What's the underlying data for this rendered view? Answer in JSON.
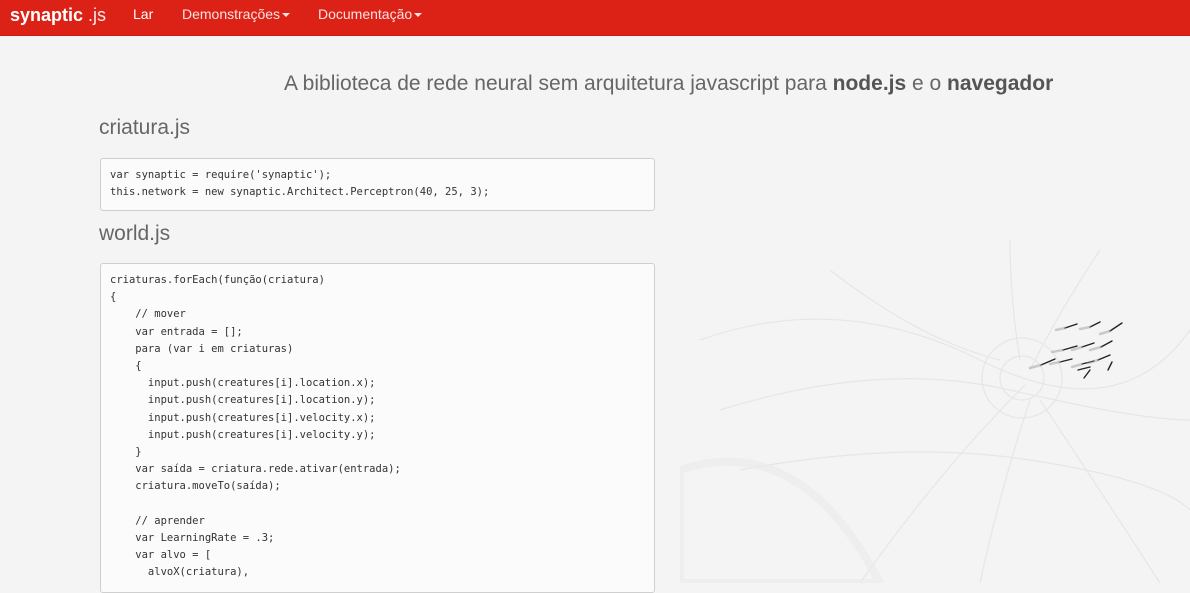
{
  "nav": {
    "brand_main": "synaptic",
    "brand_ext": ".js",
    "items": [
      {
        "label": "Lar"
      },
      {
        "label": "Demonstrações"
      },
      {
        "label": "Documentação"
      }
    ]
  },
  "hero": {
    "tagline_prefix": "A biblioteca de rede neural sem arquitetura javascript para ",
    "tagline_node": "node.js",
    "tagline_mid": " e o ",
    "tagline_browser": "navegador"
  },
  "sections": [
    {
      "title": "criatura.js",
      "code": [
        "var synaptic = require('synaptic');",
        "this.network = new synaptic.Architect.Perceptron(40, 25, 3);"
      ]
    },
    {
      "title": "world.js",
      "code": [
        "criaturas.forEach(função(criatura)",
        "{",
        "    // mover",
        "    var entrada = [];",
        "    para (var i em criaturas)",
        "    {",
        "      input.push(creatures[i].location.x);",
        "      input.push(creatures[i].location.y);",
        "      input.push(creatures[i].velocity.x);",
        "      input.push(creatures[i].velocity.y);",
        "    }",
        "    var saída = criatura.rede.ativar(entrada);",
        "    criatura.moveTo(saída);",
        "",
        "    // aprender",
        "    var LearningRate = .3;",
        "    var alvo = [",
        "      alvoX(criatura),"
      ]
    }
  ],
  "colors": {
    "navbar": "#dc2217",
    "background": "#f4f4f4"
  }
}
